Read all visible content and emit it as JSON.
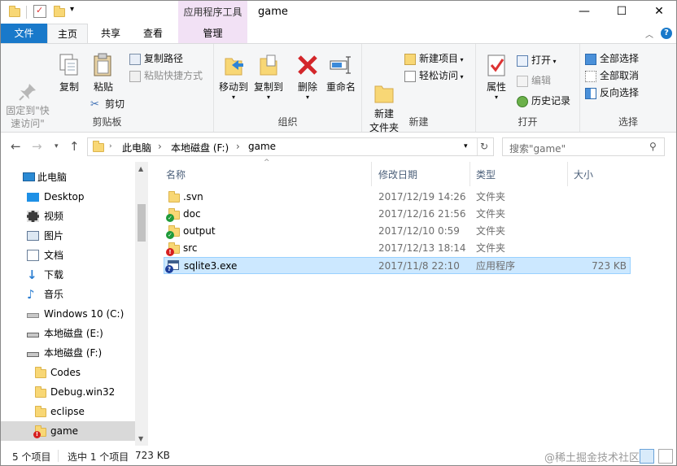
{
  "window": {
    "title": "game",
    "contextual_tab_group": "应用程序工具",
    "minimize": "—",
    "maximize": "☐",
    "close": "✕"
  },
  "tabs": {
    "file": "文件",
    "home": "主页",
    "share": "共享",
    "view": "查看",
    "manage": "管理"
  },
  "ribbon": {
    "clipboard": {
      "label": "剪贴板",
      "pin": "固定到\"快\n速访问\"",
      "copy": "复制",
      "paste": "粘贴",
      "copy_path": "复制路径",
      "paste_shortcut": "粘贴快捷方式",
      "cut": "剪切"
    },
    "organize": {
      "label": "组织",
      "move_to": "移动到",
      "copy_to": "复制到",
      "delete": "删除",
      "rename": "重命名"
    },
    "new": {
      "label": "新建",
      "new_folder": "新建\n文件夹",
      "new_item": "新建项目",
      "easy_access": "轻松访问"
    },
    "open": {
      "label": "打开",
      "properties": "属性",
      "open": "打开",
      "edit": "编辑",
      "history": "历史记录"
    },
    "select": {
      "label": "选择",
      "select_all": "全部选择",
      "select_none": "全部取消",
      "invert": "反向选择"
    }
  },
  "address": {
    "crumbs": [
      "此电脑",
      "本地磁盘 (F:)",
      "game"
    ],
    "search_placeholder": "搜索\"game\""
  },
  "nav_pane": [
    {
      "label": "此电脑",
      "icon": "computer-icon"
    },
    {
      "label": "Desktop",
      "icon": "desktop-icon"
    },
    {
      "label": "视频",
      "icon": "video-icon"
    },
    {
      "label": "图片",
      "icon": "pictures-icon"
    },
    {
      "label": "文档",
      "icon": "documents-icon"
    },
    {
      "label": "下载",
      "icon": "download-icon"
    },
    {
      "label": "音乐",
      "icon": "music-icon"
    },
    {
      "label": "Windows 10 (C:)",
      "icon": "windows-drive-icon"
    },
    {
      "label": "本地磁盘 (E:)",
      "icon": "drive-icon"
    },
    {
      "label": "本地磁盘 (F:)",
      "icon": "drive-icon"
    },
    {
      "label": "Codes",
      "icon": "folder-icon"
    },
    {
      "label": "Debug.win32",
      "icon": "folder-icon"
    },
    {
      "label": "eclipse",
      "icon": "folder-icon"
    },
    {
      "label": "game",
      "icon": "svn-conflict-folder-icon",
      "selected": true
    }
  ],
  "columns": {
    "name": "名称",
    "date": "修改日期",
    "type": "类型",
    "size": "大小"
  },
  "files": [
    {
      "name": ".svn",
      "date": "2017/12/19 14:26",
      "type": "文件夹",
      "size": "",
      "icon": "folder-icon"
    },
    {
      "name": "doc",
      "date": "2017/12/16 21:56",
      "type": "文件夹",
      "size": "",
      "icon": "svn-ok-folder-icon"
    },
    {
      "name": "output",
      "date": "2017/12/10 0:59",
      "type": "文件夹",
      "size": "",
      "icon": "svn-ok-folder-icon"
    },
    {
      "name": "src",
      "date": "2017/12/13 18:14",
      "type": "文件夹",
      "size": "",
      "icon": "svn-conflict-folder-icon"
    },
    {
      "name": "sqlite3.exe",
      "date": "2017/11/8 22:10",
      "type": "应用程序",
      "size": "723 KB",
      "icon": "exe-icon",
      "selected": true
    }
  ],
  "status": {
    "count": "5 个项目",
    "selected": "选中 1 个项目",
    "size": "723 KB",
    "watermark": "@稀土掘金技术社区"
  },
  "colors": {
    "file_tab": "#1979ca",
    "context_tab": "#f2e1f5",
    "selection": "#cce8ff",
    "folder": "#f8d775"
  }
}
